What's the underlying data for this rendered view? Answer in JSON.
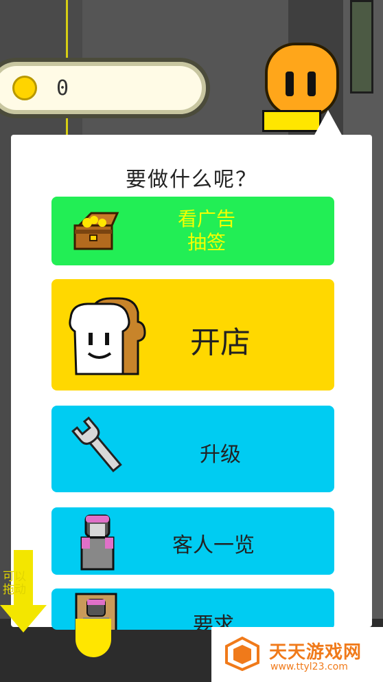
{
  "hud": {
    "coins": "0"
  },
  "dialog": {
    "title": "要做什么呢？",
    "items": [
      {
        "id": "ad",
        "label_line1": "看广告",
        "label_line2": "抽签",
        "icon": "treasure-chest-icon"
      },
      {
        "id": "open",
        "label": "开店",
        "icon": "bread-icon"
      },
      {
        "id": "upgrade",
        "label": "升级",
        "icon": "wrench-icon"
      },
      {
        "id": "customers",
        "label": "客人一览",
        "icon": "customer-icon"
      },
      {
        "id": "request",
        "label": "要求",
        "icon": "portrait-icon"
      }
    ]
  },
  "scroll_hint": {
    "line1": "可以",
    "line2": "拖动"
  },
  "watermark": {
    "name": "天天游戏网",
    "url": "www.ttyl23.com"
  },
  "colors": {
    "ad_button": "#22ee55",
    "open_button": "#ffd800",
    "blue_button": "#00ccf2",
    "coin": "#ffd400",
    "watermark": "#f07a1a"
  }
}
